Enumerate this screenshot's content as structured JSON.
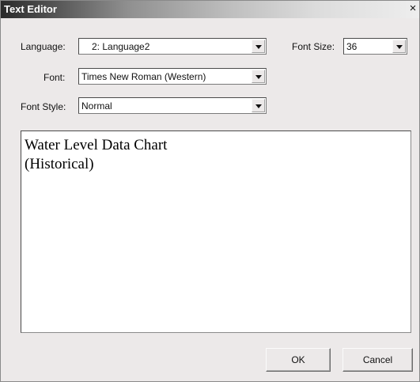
{
  "window": {
    "title": "Text Editor",
    "close_glyph": "×"
  },
  "fields": {
    "language_label": "Language:",
    "language_value": "2: Language2",
    "font_size_label": "Font Size:",
    "font_size_value": "36",
    "font_label": "Font:",
    "font_value": "Times New Roman (Western)",
    "font_style_label": "Font Style:",
    "font_style_value": "Normal"
  },
  "editor": {
    "text": "Water Level Data Chart\n(Historical)"
  },
  "buttons": {
    "ok_label": "OK",
    "cancel_label": "Cancel"
  }
}
